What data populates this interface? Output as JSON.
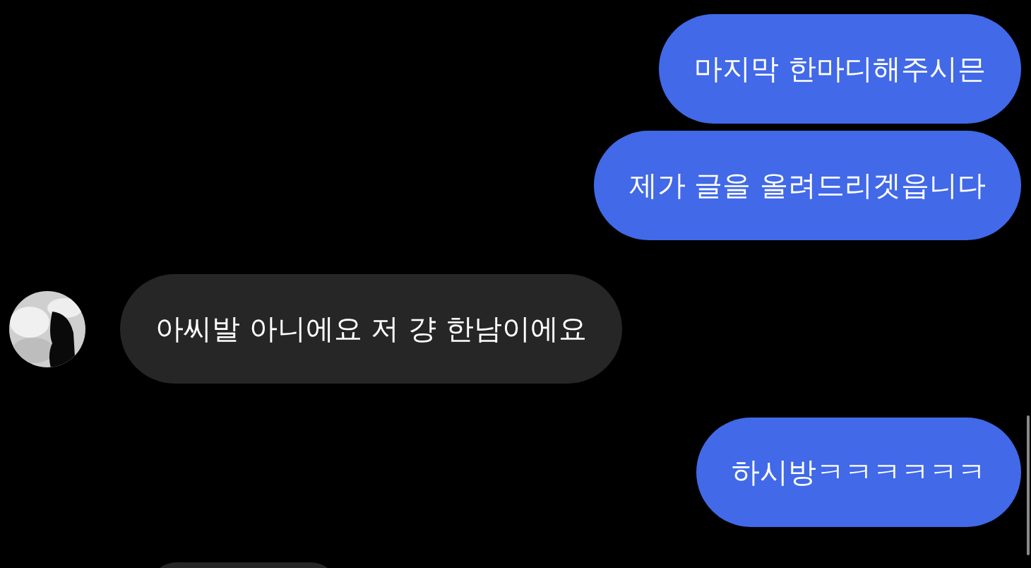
{
  "messages": [
    {
      "kind": "sent",
      "text": "마지막 한마디해주시믄"
    },
    {
      "kind": "sent",
      "text": "제가 글을 올려드리겟읍니다"
    },
    {
      "kind": "received",
      "text": "아씨발 아니에요 저 걍 한남이에요"
    },
    {
      "kind": "sent",
      "text": "하시방ㅋㅋㅋㅋㅋㅋ"
    }
  ]
}
